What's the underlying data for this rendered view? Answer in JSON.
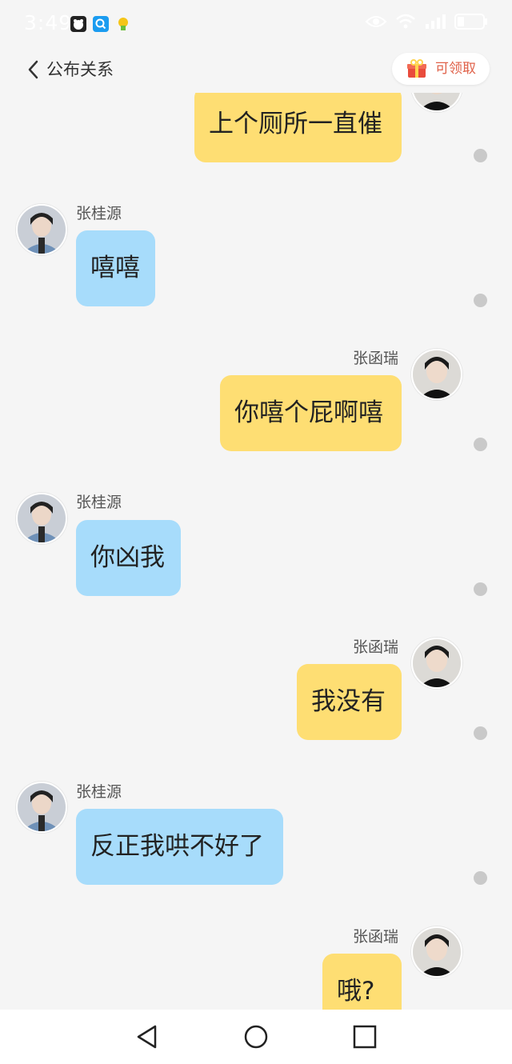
{
  "status_bar": {
    "time": "3:49",
    "notification_icons": [
      "bear-icon",
      "search-app-icon",
      "android-icon"
    ],
    "system_icons": [
      "eye-icon",
      "wifi-icon",
      "signal-icon",
      "battery-icon"
    ]
  },
  "header": {
    "title": "公布关系",
    "reward_label": "可领取"
  },
  "chat": {
    "messages": [
      {
        "sender": "",
        "text": "上个厕所一直催",
        "side": "right"
      },
      {
        "sender": "张桂源",
        "text": "嘻嘻",
        "side": "left"
      },
      {
        "sender": "张函瑞",
        "text": "你嘻个屁啊嘻",
        "side": "right"
      },
      {
        "sender": "张桂源",
        "text": "你凶我",
        "side": "left"
      },
      {
        "sender": "张函瑞",
        "text": "我没有",
        "side": "right"
      },
      {
        "sender": "张桂源",
        "text": "反正我哄不好了",
        "side": "left"
      },
      {
        "sender": "张函瑞",
        "text": "哦?",
        "side": "right"
      }
    ]
  },
  "nav_bar": {
    "buttons": [
      "back-triangle-icon",
      "home-circle-icon",
      "recents-square-icon"
    ]
  },
  "colors": {
    "my_bubble": "#fede73",
    "their_bubble": "#a7dcfb",
    "background": "#f5f5f5",
    "reward_text": "#e0624a"
  }
}
